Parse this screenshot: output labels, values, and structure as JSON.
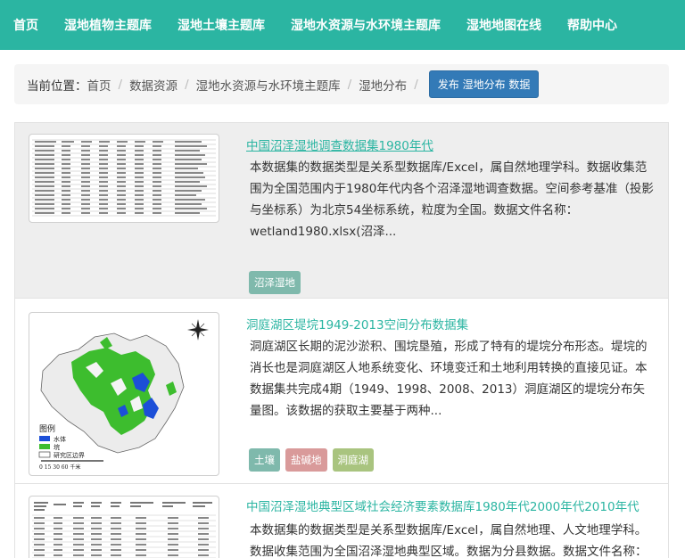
{
  "nav": {
    "items": [
      "首页",
      "湿地植物主题库",
      "湿地土壤主题库",
      "湿地水资源与水环境主题库",
      "湿地地图在线",
      "帮助中心"
    ]
  },
  "breadcrumb": {
    "label": "当前位置：",
    "links": [
      "首页",
      "数据资源",
      "湿地水资源与水环境主题库",
      "湿地分布"
    ],
    "button": "发布 湿地分布 数据"
  },
  "results": [
    {
      "title": "中国沼泽湿地调查数据集1980年代",
      "description": "本数据集的数据类型是关系型数据库/Excel，属自然地理学科。数据收集范围为全国范围内于1980年代内各个沼泽湿地调查数据。空间参考基准（投影与坐标系）为北京54坐标系统，粒度为全国。数据文件名称：wetland1980.xlsx(沼泽...",
      "tags": [
        {
          "label": "沼泽湿地",
          "color": "#7fb9ac"
        }
      ]
    },
    {
      "title": "洞庭湖区堤垸1949-2013空间分布数据集",
      "description": "洞庭湖区长期的泥沙淤积、围垸垦殖，形成了特有的堤垸分布形态。堤垸的消长也是洞庭湖区人地系统变化、环境变迁和土地利用转换的直接见证。本数据集共完成4期（1949、1998、2008、2013）洞庭湖区的堤垸分布矢量图。该数据的获取主要基于两种...",
      "tags": [
        {
          "label": "土壤",
          "color": "#7fb9ac"
        },
        {
          "label": "盐碱地",
          "color": "#d99a9a"
        },
        {
          "label": "洞庭湖",
          "color": "#a9c47f"
        }
      ],
      "map": {
        "legend_title": "图例",
        "legend_items": [
          "水体",
          "垸",
          "研究区边界"
        ],
        "scale_label": "0  15  30       60 千米"
      }
    },
    {
      "title": "中国沼泽湿地典型区域社会经济要素数据库1980年代2000年代2010年代",
      "description": "本数据集的数据类型是关系型数据库/Excel，属自然地理、人文地理学科。数据收集范围为全国沼泽湿地典型区域。数据为分县数据。数据文件名称：",
      "tags": []
    }
  ]
}
